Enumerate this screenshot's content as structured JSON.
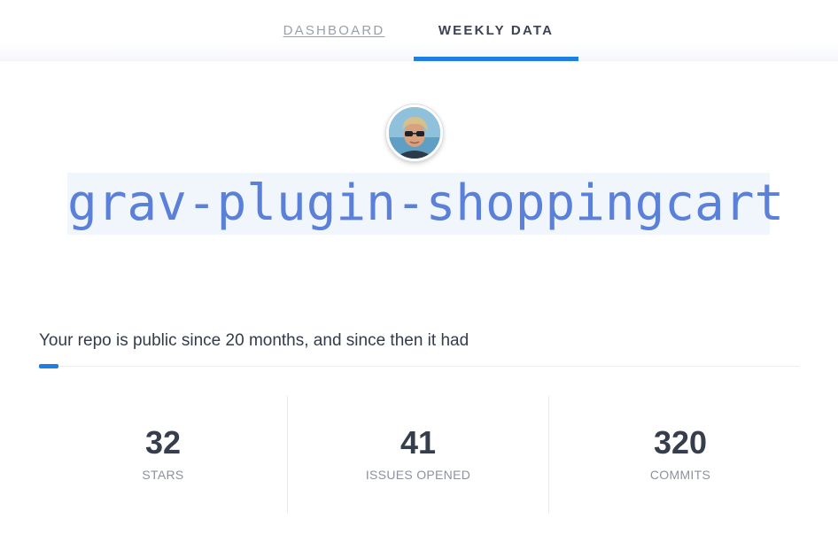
{
  "nav": {
    "tabs": [
      {
        "label": "DASHBOARD",
        "active": false
      },
      {
        "label": "WEEKLY DATA",
        "active": true
      }
    ],
    "accent_color": "#1d7fe3"
  },
  "repo": {
    "name": "grav-plugin-shoppingcart",
    "avatar": "user-avatar-photo"
  },
  "summary": {
    "intro": "Your repo is public since 20 months, and since then it had"
  },
  "stats": [
    {
      "value": "32",
      "label": "STARS"
    },
    {
      "value": "41",
      "label": "ISSUES OPENED"
    },
    {
      "value": "320",
      "label": "COMMITS"
    }
  ]
}
